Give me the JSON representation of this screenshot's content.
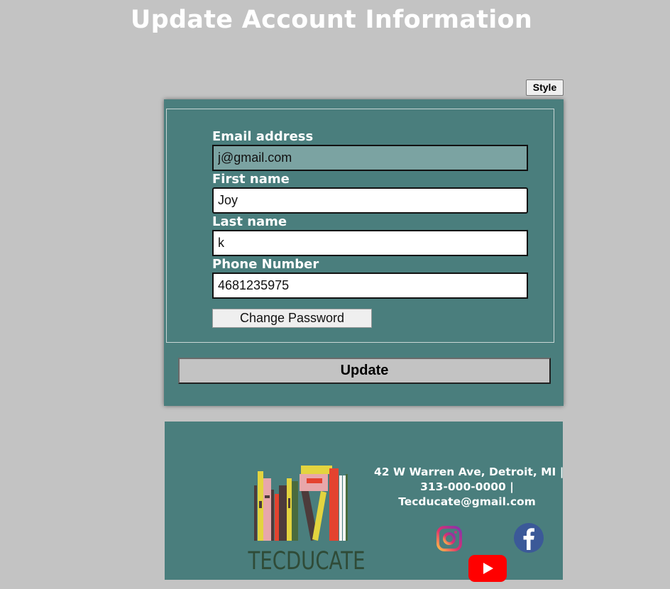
{
  "page": {
    "title": "Update Account Information"
  },
  "toolbar": {
    "style_label": "Style"
  },
  "form": {
    "email": {
      "label": "Email address",
      "value": "j@gmail.com"
    },
    "first_name": {
      "label": "First name",
      "value": "Joy"
    },
    "last_name": {
      "label": "Last name",
      "value": "k"
    },
    "phone": {
      "label": "Phone Number",
      "value": "4681235975"
    },
    "change_password_label": "Change Password",
    "update_label": "Update"
  },
  "footer": {
    "logo_text": "TECDUCATE",
    "address_line": "42 W Warren Ave, Detroit, MI |",
    "phone_line": "313-000-0000 |",
    "email_line": "Tecducate@gmail.com",
    "social_icons": [
      "instagram-icon",
      "facebook-icon",
      "youtube-icon"
    ]
  },
  "colors": {
    "background": "#c3c3c3",
    "panel": "#4a7e7d",
    "readonly_input": "#7ba3a2",
    "youtube_red": "#ff0000",
    "facebook_blue": "#3b5998"
  }
}
